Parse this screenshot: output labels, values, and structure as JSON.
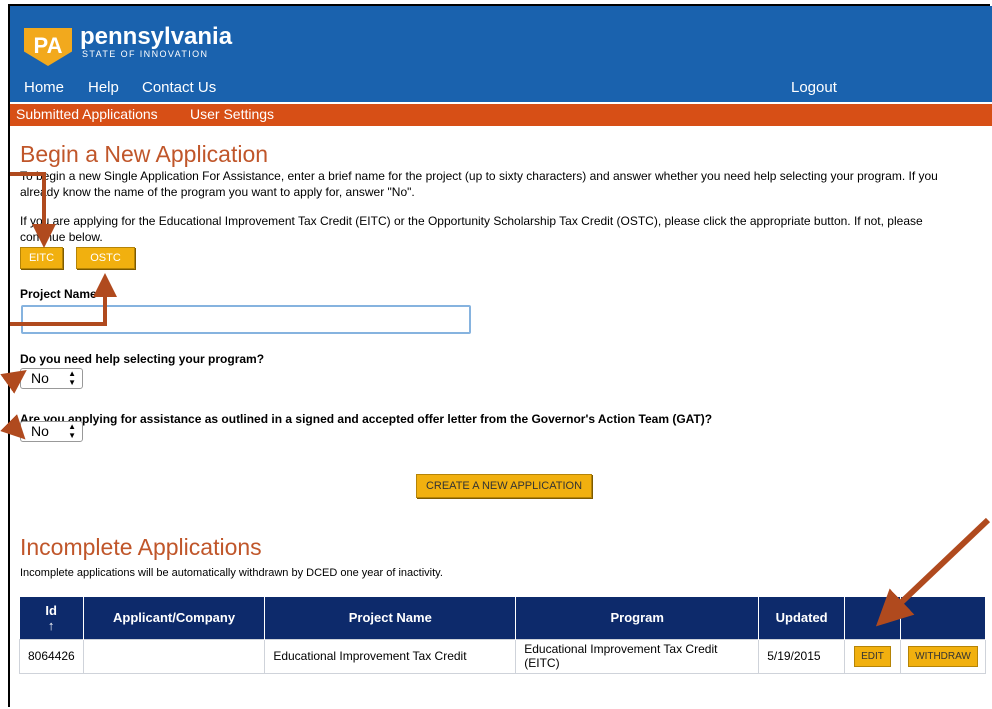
{
  "header": {
    "logo_badge": "PA",
    "logo_name": "pennsylvania",
    "logo_tagline": "STATE OF INNOVATION"
  },
  "nav": {
    "home": "Home",
    "help": "Help",
    "contact": "Contact Us",
    "logout": "Logout"
  },
  "subnav": {
    "submitted": "Submitted Applications",
    "settings": "User Settings"
  },
  "begin": {
    "title": "Begin a New Application",
    "intro_line1": "To begin a new Single Application For Assistance, enter a brief name for the project (up to sixty characters) and answer whether you need help selecting your program. If you",
    "intro_line2": "already know the name of the program you want to apply for, answer \"No\".",
    "tax_line1": "If you are applying for the Educational Improvement Tax Credit (EITC) or the Opportunity Scholarship Tax Credit (OSTC), please click the appropriate button. If not, please",
    "tax_line2": "continue below.",
    "eitc_label": "EITC",
    "ostc_label": "OSTC",
    "project_name_label": "Project Name",
    "project_name_value": "",
    "help_question": "Do you need help selecting your program?",
    "help_value": "No",
    "gat_question": "Are you applying for assistance as outlined in a signed and accepted offer letter from the Governor's Action Team (GAT)?",
    "gat_value": "No",
    "create_label": "CREATE A NEW APPLICATION"
  },
  "incomplete": {
    "title": "Incomplete Applications",
    "note": "Incomplete applications will be automatically withdrawn by DCED one year of inactivity.",
    "columns": [
      "Id",
      "Applicant/Company",
      "Project Name",
      "Program",
      "Updated"
    ],
    "sort_indicator": "↑",
    "rows": [
      {
        "id": "8064426",
        "company": "",
        "project": "Educational Improvement Tax Credit",
        "program_line1": "Educational Improvement Tax Credit",
        "program_line2": "(EITC)",
        "updated": "5/19/2015",
        "edit_label": "EDIT",
        "withdraw_label": "WITHDRAW"
      }
    ]
  },
  "colors": {
    "header_blue": "#1a62ae",
    "subnav_orange": "#d74f16",
    "heading_orange": "#c0562a",
    "button_yellow": "#f1b00f",
    "table_header_navy": "#0d2a6b",
    "annotation_arrow": "#b04a1e"
  }
}
